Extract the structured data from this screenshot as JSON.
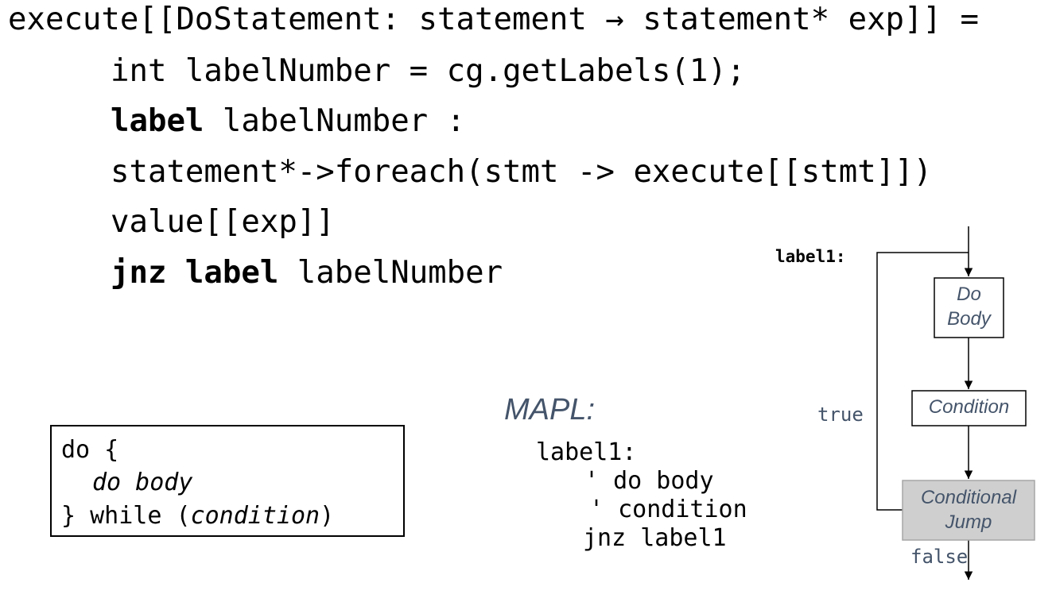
{
  "rule": {
    "header": "execute[[DoStatement: statement → statement* exp]] =",
    "line1": "int labelNumber = cg.getLabels(1);",
    "line2_kw": "label",
    "line2_rest": " labelNumber :",
    "line3": "statement*->foreach(stmt -> execute[[stmt]])",
    "line4": "value[[exp]]",
    "line5_kw": "jnz label",
    "line5_rest": " labelNumber"
  },
  "source_box": {
    "line1": "do {",
    "line2": "do body",
    "line3_pre": "} while (",
    "line3_italic": "condition",
    "line3_post": ")"
  },
  "mapl": {
    "title": "MAPL:",
    "line1": "label1:",
    "line2": "' do body",
    "line3": "' condition",
    "line4": "jnz label1"
  },
  "flowchart": {
    "entry_label": "label1:",
    "nodes": {
      "do_body": [
        "Do",
        "Body"
      ],
      "condition": [
        "Condition"
      ],
      "cond_jump": [
        "Conditional",
        "Jump"
      ]
    },
    "true_label": "true",
    "false_label": "false",
    "colors": {
      "node_text": "#44546a",
      "jump_fill": "#cfcfcf",
      "edge_label": "#44546a"
    }
  }
}
